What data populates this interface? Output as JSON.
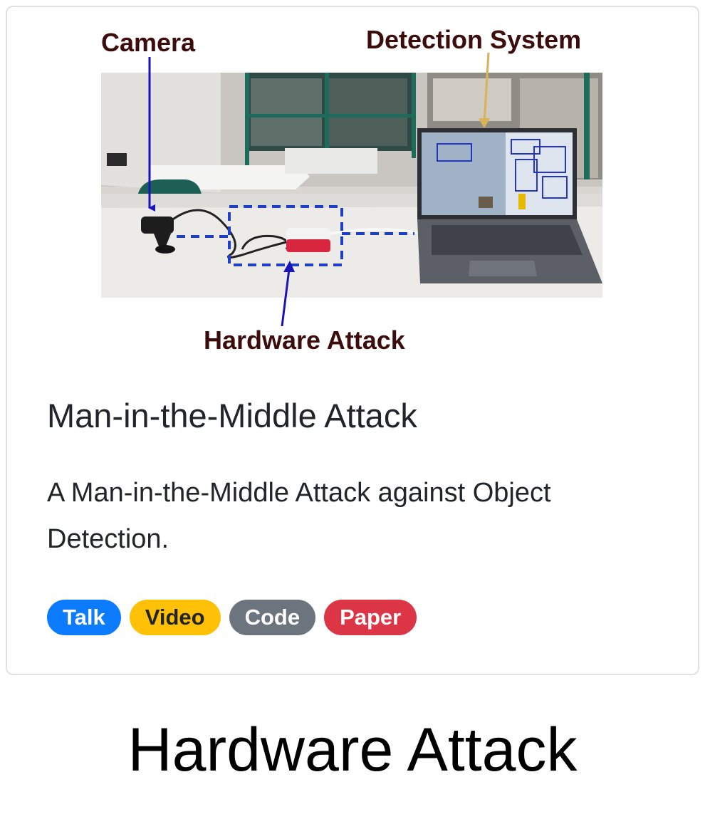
{
  "figure": {
    "labels": {
      "camera": "Camera",
      "detection_system": "Detection System",
      "hardware_attack": "Hardware Attack"
    },
    "colors": {
      "label_text": "#3d0d0d",
      "arrow_camera": "#1a14b8",
      "arrow_detection": "#d9b25a",
      "dashed_link": "#1f3fc4"
    }
  },
  "card": {
    "title": "Man-in-the-Middle Attack",
    "text": "A Man-in-the-Middle Attack against Object Detection.",
    "badges": {
      "talk": "Talk",
      "video": "Video",
      "code": "Code",
      "paper": "Paper"
    },
    "badge_colors": {
      "talk": "#0d7bfd",
      "video": "#ffc107",
      "code": "#6c757d",
      "paper": "#dc3545"
    }
  },
  "caption": "Hardware Attack"
}
